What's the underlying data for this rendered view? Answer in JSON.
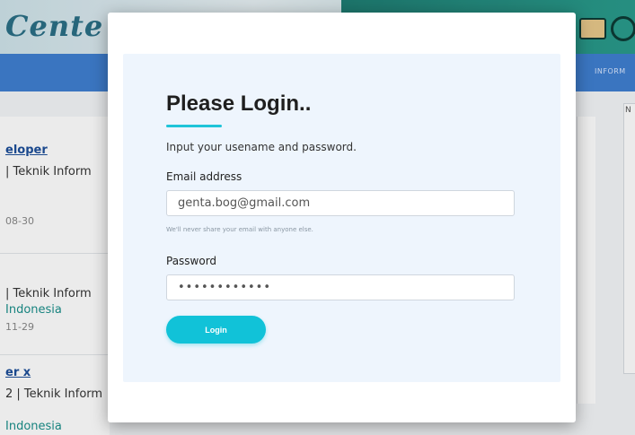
{
  "background": {
    "brand_text": "Cente",
    "nav_item": "INFORM",
    "side_label": "N",
    "listings": [
      {
        "title": "eloper",
        "meta": "| Teknik Inform",
        "date": "08-30"
      },
      {
        "meta": "| Teknik Inform",
        "location": "Indonesia",
        "date": "11-29"
      },
      {
        "title": "er x",
        "meta": "2 | Teknik Inform",
        "location": "Indonesia"
      }
    ]
  },
  "modal": {
    "title": "Please Login..",
    "subtitle": "Input your usename and password.",
    "email": {
      "label": "Email address",
      "value": "genta.bog@gmail.com",
      "help": "We'll never share your email with anyone else."
    },
    "password": {
      "label": "Password",
      "value": "••••••••••••"
    },
    "submit_label": "Login"
  },
  "colors": {
    "accent": "#11c2d8",
    "panel_bg": "#eef5fd",
    "nav_bg": "#3f7fd1"
  }
}
